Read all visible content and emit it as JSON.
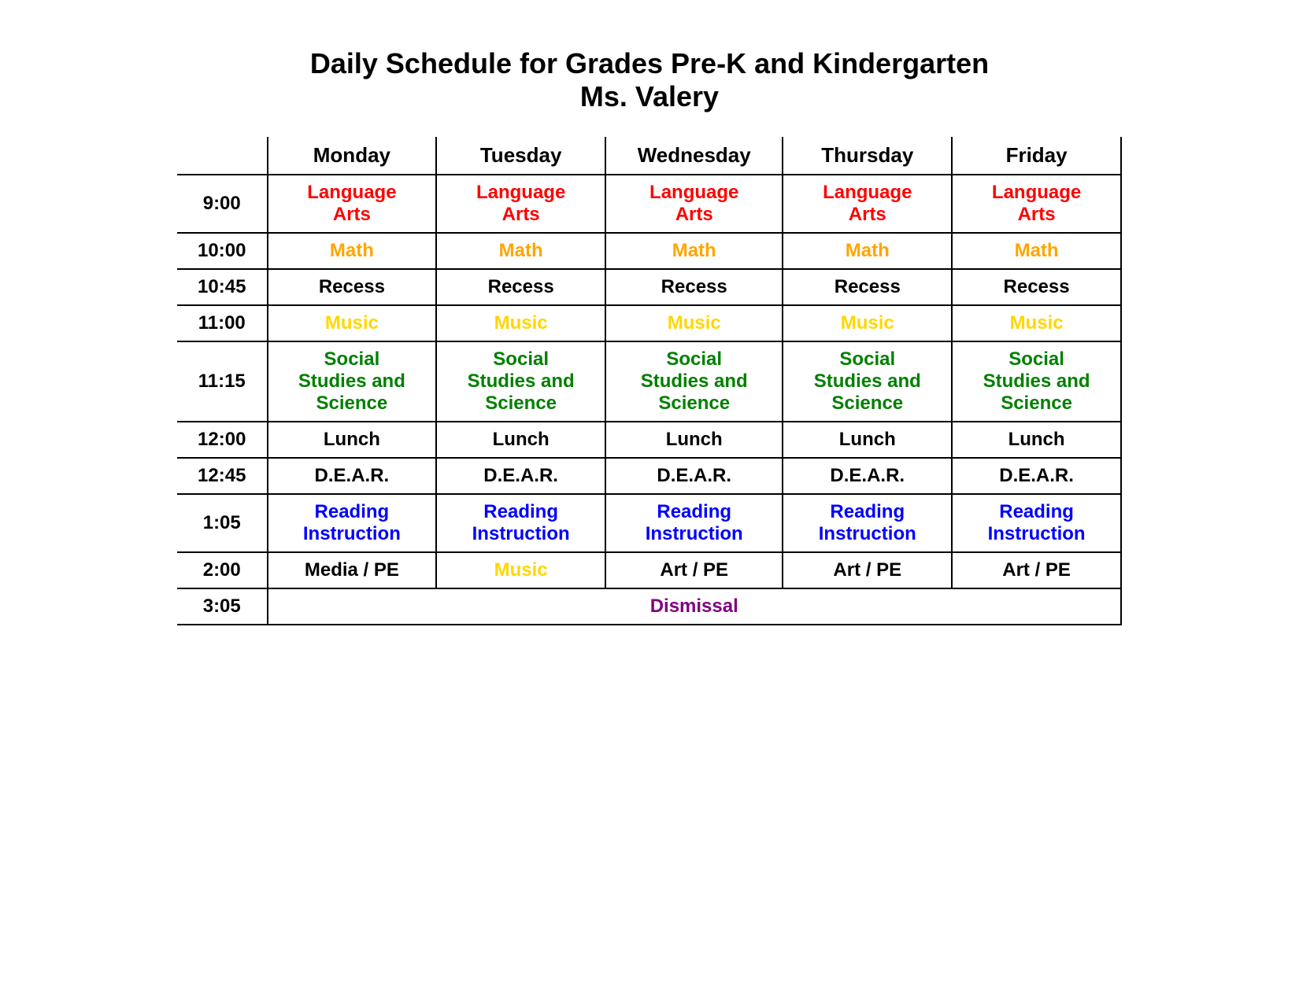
{
  "title": {
    "line1": "Daily Schedule for Grades Pre-K and Kindergarten",
    "line2": "Ms. Valery"
  },
  "headers": {
    "blank": "",
    "monday": "Monday",
    "tuesday": "Tuesday",
    "wednesday": "Wednesday",
    "thursday": "Thursday",
    "friday": "Friday"
  },
  "rows": [
    {
      "time": "9:00",
      "cells": [
        "Language Arts",
        "Language Arts",
        "Language Arts",
        "Language Arts",
        "Language Arts"
      ],
      "class": "language-arts"
    },
    {
      "time": "10:00",
      "cells": [
        "Math",
        "Math",
        "Math",
        "Math",
        "Math"
      ],
      "class": "math"
    },
    {
      "time": "10:45",
      "cells": [
        "Recess",
        "Recess",
        "Recess",
        "Recess",
        "Recess"
      ],
      "class": "recess"
    },
    {
      "time": "11:00",
      "cells": [
        "Music",
        "Music",
        "Music",
        "Music",
        "Music"
      ],
      "class": "music"
    },
    {
      "time": "11:15",
      "cells": [
        "Social Studies and Science",
        "Social Studies and Science",
        "Social Studies and Science",
        "Social Studies and Science",
        "Social Studies and Science"
      ],
      "class": "social-studies"
    },
    {
      "time": "12:00",
      "cells": [
        "Lunch",
        "Lunch",
        "Lunch",
        "Lunch",
        "Lunch"
      ],
      "class": "lunch"
    },
    {
      "time": "12:45",
      "cells": [
        "D.E.A.R.",
        "D.E.A.R.",
        "D.E.A.R.",
        "D.E.A.R.",
        "D.E.A.R."
      ],
      "class": "dear"
    },
    {
      "time": "1:05",
      "cells": [
        "Reading Instruction",
        "Reading Instruction",
        "Reading Instruction",
        "Reading Instruction",
        "Reading Instruction"
      ],
      "class": "reading"
    },
    {
      "time": "2:00",
      "cells": [
        "Media / PE",
        "Music",
        "Art / PE",
        "Art / PE",
        "Art / PE"
      ],
      "class": "media-pe"
    },
    {
      "time": "3:05",
      "cells": [
        "Dismissal"
      ],
      "class": "dismissal",
      "colspan": 5
    }
  ]
}
